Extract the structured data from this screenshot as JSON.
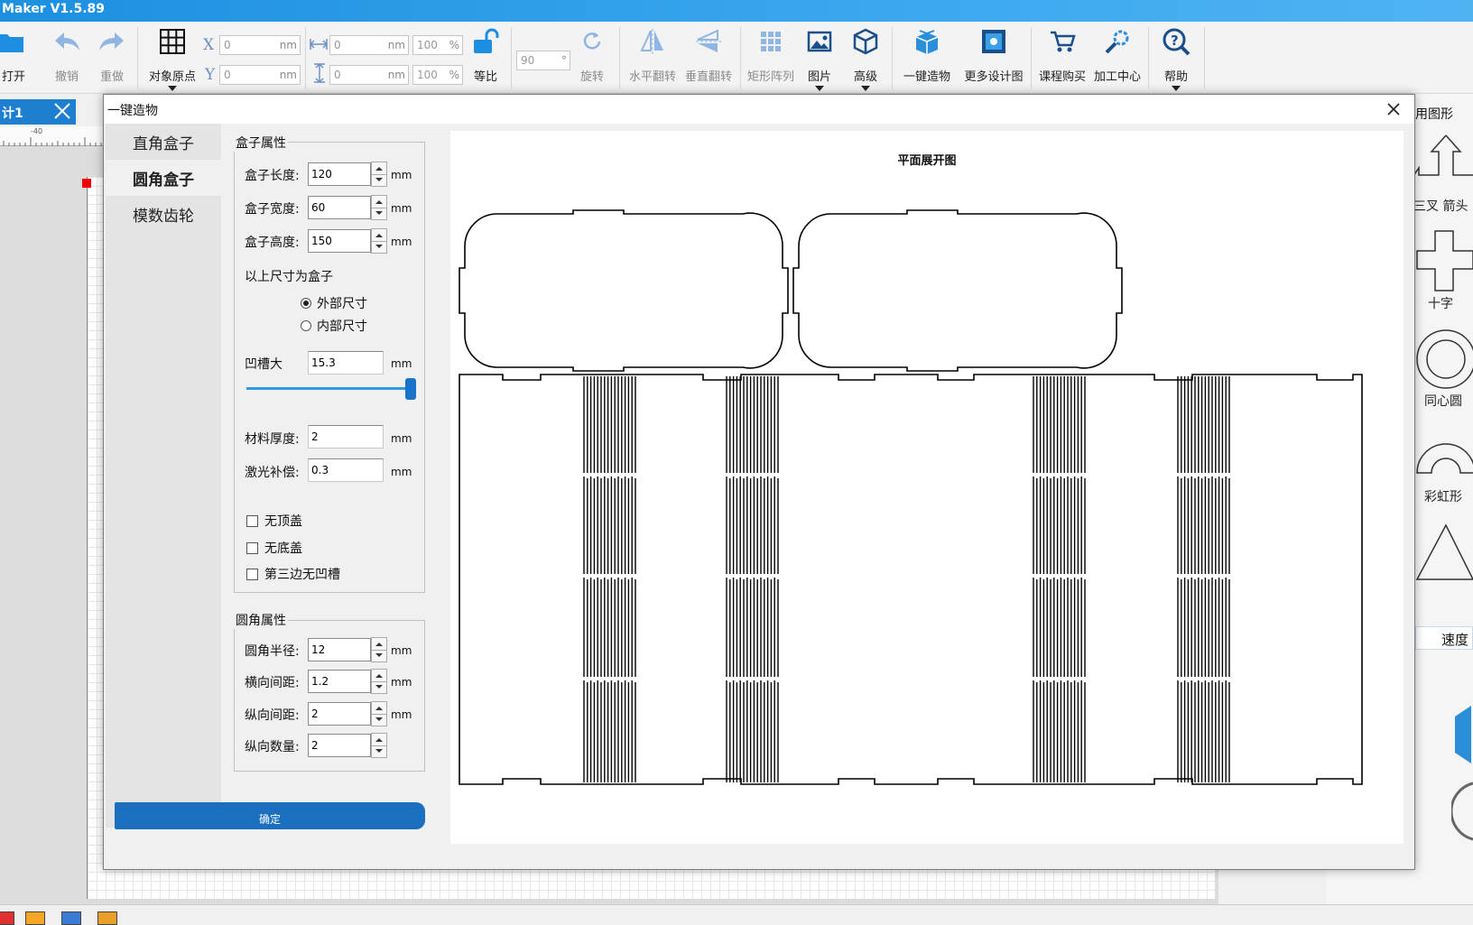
{
  "window": {
    "title": "Maker V1.5.89"
  },
  "toolbar": {
    "open": "打开",
    "undo": "撤销",
    "redo": "重做",
    "object_origin": "对象原点",
    "x_value": "0",
    "y_value": "0",
    "w_value": "0",
    "h_value": "0",
    "unit_nm": "nm",
    "scale_w": "100",
    "scale_h": "100",
    "percent": "%",
    "proportional": "等比",
    "rotate_value": "90",
    "degree": "°",
    "rotate": "旋转",
    "flip_h": "水平翻转",
    "flip_v": "垂直翻转",
    "rect_array": "矩形阵列",
    "image": "图片",
    "advanced": "高级",
    "one_click": "一键造物",
    "more_designs": "更多设计图",
    "course_purchase": "课程购买",
    "processing_center": "加工中心",
    "help": "帮助"
  },
  "workspace": {
    "doc_tab": "计1",
    "ruler_label": "-40"
  },
  "right_panel": {
    "title": "用图形",
    "shapes": [
      "三叉 箭头",
      "十字",
      "同心圆",
      "彩虹形"
    ],
    "speed_header": "速度"
  },
  "dialog": {
    "title": "一键造物",
    "tabs": [
      "直角盒子",
      "圆角盒子",
      "模数齿轮"
    ],
    "box_group": {
      "title": "盒子属性",
      "length_label": "盒子长度:",
      "length_value": "120",
      "width_label": "盒子宽度:",
      "width_value": "60",
      "height_label": "盒子高度:",
      "height_value": "150",
      "unit": "mm",
      "size_as": "以上尺寸为盒子",
      "outer": "外部尺寸",
      "inner": "内部尺寸",
      "selected": "outer",
      "groove_label": "凹槽大",
      "groove_value": "15.3",
      "material_label": "材料厚度:",
      "material_value": "2",
      "laser_label": "激光补偿:",
      "laser_value": "0.3",
      "no_top": "无顶盖",
      "no_bottom": "无底盖",
      "third_side_no_groove": "第三边无凹槽"
    },
    "round_group": {
      "title": "圆角属性",
      "radius_label": "圆角半径:",
      "radius_value": "12",
      "h_spacing_label": "横向间距:",
      "h_spacing_value": "1.2",
      "v_spacing_label": "纵向间距:",
      "v_spacing_value": "2",
      "v_count_label": "纵向数量:",
      "v_count_value": "2",
      "unit": "mm"
    },
    "confirm": "确定",
    "preview_title": "平面展开图"
  },
  "colors": {
    "accent": "#1a6fbf",
    "title_bar": "#2a9ce8",
    "marker": "#e00000"
  },
  "swatch_colors": [
    "#e03030",
    "#f5a623",
    "#3a7bd5",
    "#e8a02a"
  ]
}
